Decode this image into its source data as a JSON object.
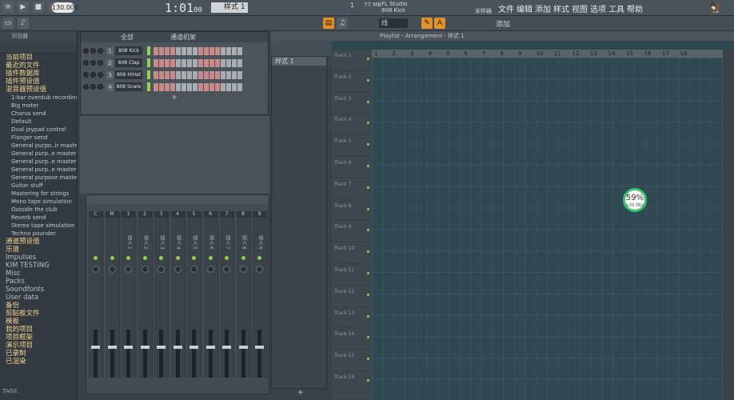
{
  "transport": {
    "tempo": "130.000",
    "time": "1:01",
    "time_sub": "00",
    "pattern": "样式 1"
  },
  "info": {
    "mem": "77 MB",
    "cpu_line": "1",
    "app": "FL Studio",
    "plugin": "808 Kick",
    "mode": "宋样器"
  },
  "menu": [
    "文件",
    "编辑",
    "添加",
    "样式",
    "视图",
    "选项",
    "工具",
    "帮助"
  ],
  "toolbar2": {
    "snap": "线",
    "add": "添加"
  },
  "browser": {
    "header": "浏览器",
    "items": [
      {
        "label": "当前项目",
        "kind": "cat"
      },
      {
        "label": "最近的文件",
        "kind": "cat"
      },
      {
        "label": "插件数据库",
        "kind": "cat"
      },
      {
        "label": "插件预设值",
        "kind": "cat"
      },
      {
        "label": "混音器预设值",
        "kind": "cat"
      },
      {
        "label": "1-bar overdub recording",
        "kind": "sub"
      },
      {
        "label": "Big meter",
        "kind": "sub"
      },
      {
        "label": "Chorus send",
        "kind": "sub"
      },
      {
        "label": "Default",
        "kind": "sub"
      },
      {
        "label": "Dual joypad control",
        "kind": "sub"
      },
      {
        "label": "Flanger send",
        "kind": "sub"
      },
      {
        "label": "General purpo..ir mastering",
        "kind": "sub"
      },
      {
        "label": "General purp..e mastering 2",
        "kind": "sub"
      },
      {
        "label": "General purp..e mastering 3",
        "kind": "sub"
      },
      {
        "label": "General purp..e mastering 4",
        "kind": "sub"
      },
      {
        "label": "General purpose mastering",
        "kind": "sub"
      },
      {
        "label": "Guitar stuff",
        "kind": "sub"
      },
      {
        "label": "Mastering for strings",
        "kind": "sub"
      },
      {
        "label": "Mono tape simulation",
        "kind": "sub"
      },
      {
        "label": "Outside the club",
        "kind": "sub"
      },
      {
        "label": "Reverb send",
        "kind": "sub"
      },
      {
        "label": "Stereo tape simulation",
        "kind": "sub"
      },
      {
        "label": "Techno pounder",
        "kind": "sub"
      },
      {
        "label": "通道预设值",
        "kind": "cat"
      },
      {
        "label": "乐谱",
        "kind": "cat"
      },
      {
        "label": "Impulses",
        "kind": "gray"
      },
      {
        "label": "KIM TESTING",
        "kind": "gray"
      },
      {
        "label": "Misc",
        "kind": "gray"
      },
      {
        "label": "Packs",
        "kind": "gray"
      },
      {
        "label": "Soundfonts",
        "kind": "gray"
      },
      {
        "label": "User data",
        "kind": "gray"
      },
      {
        "label": "备份",
        "kind": "cat"
      },
      {
        "label": "剪贴板文件",
        "kind": "cat"
      },
      {
        "label": "模板",
        "kind": "cat"
      },
      {
        "label": "我的项目",
        "kind": "cat"
      },
      {
        "label": "项目框架",
        "kind": "cat"
      },
      {
        "label": "演示项目",
        "kind": "cat"
      },
      {
        "label": "已录制",
        "kind": "cat"
      },
      {
        "label": "已渲染",
        "kind": "cat"
      }
    ],
    "tags": "TAGS"
  },
  "rack": {
    "filter": "全部",
    "title": "通道机架",
    "channels": [
      {
        "num": "1",
        "name": "808 Kick"
      },
      {
        "num": "2",
        "name": "808 Clap"
      },
      {
        "num": "3",
        "name": "808 HiHat"
      },
      {
        "num": "4",
        "name": "808 Snare"
      }
    ]
  },
  "mixer": {
    "strips": [
      "C",
      "M",
      "1",
      "2",
      "3",
      "4",
      "5",
      "6",
      "7",
      "8",
      "9"
    ],
    "inserts": [
      "插入 1",
      "插入 2",
      "插入 3",
      "插入 4",
      "插入 5",
      "插入 6",
      "插入 7",
      "插入 8",
      "插入 9"
    ]
  },
  "patterns": {
    "item": "样式 1"
  },
  "playlist": {
    "title": "Playlist - Arrangement - 样式 1",
    "bars": [
      "1",
      "2",
      "3",
      "4",
      "5",
      "6",
      "7",
      "8",
      "9",
      "10",
      "11",
      "12",
      "13",
      "14",
      "15",
      "16",
      "17",
      "18"
    ],
    "tracks": [
      "Track 1",
      "Track 2",
      "Track 3",
      "Track 4",
      "Track 5",
      "Track 6",
      "Track 7",
      "Track 8",
      "Track 9",
      "Track 10",
      "Track 11",
      "Track 12",
      "Track 13",
      "Track 14",
      "Track 15",
      "Track 16"
    ]
  },
  "cpu": {
    "percent": "59%",
    "rate": "+33.7K/s"
  },
  "colors": {
    "accent": "#e3922b",
    "cpu_ring": "#39c56b",
    "playlist_bg": "#2f4852"
  }
}
